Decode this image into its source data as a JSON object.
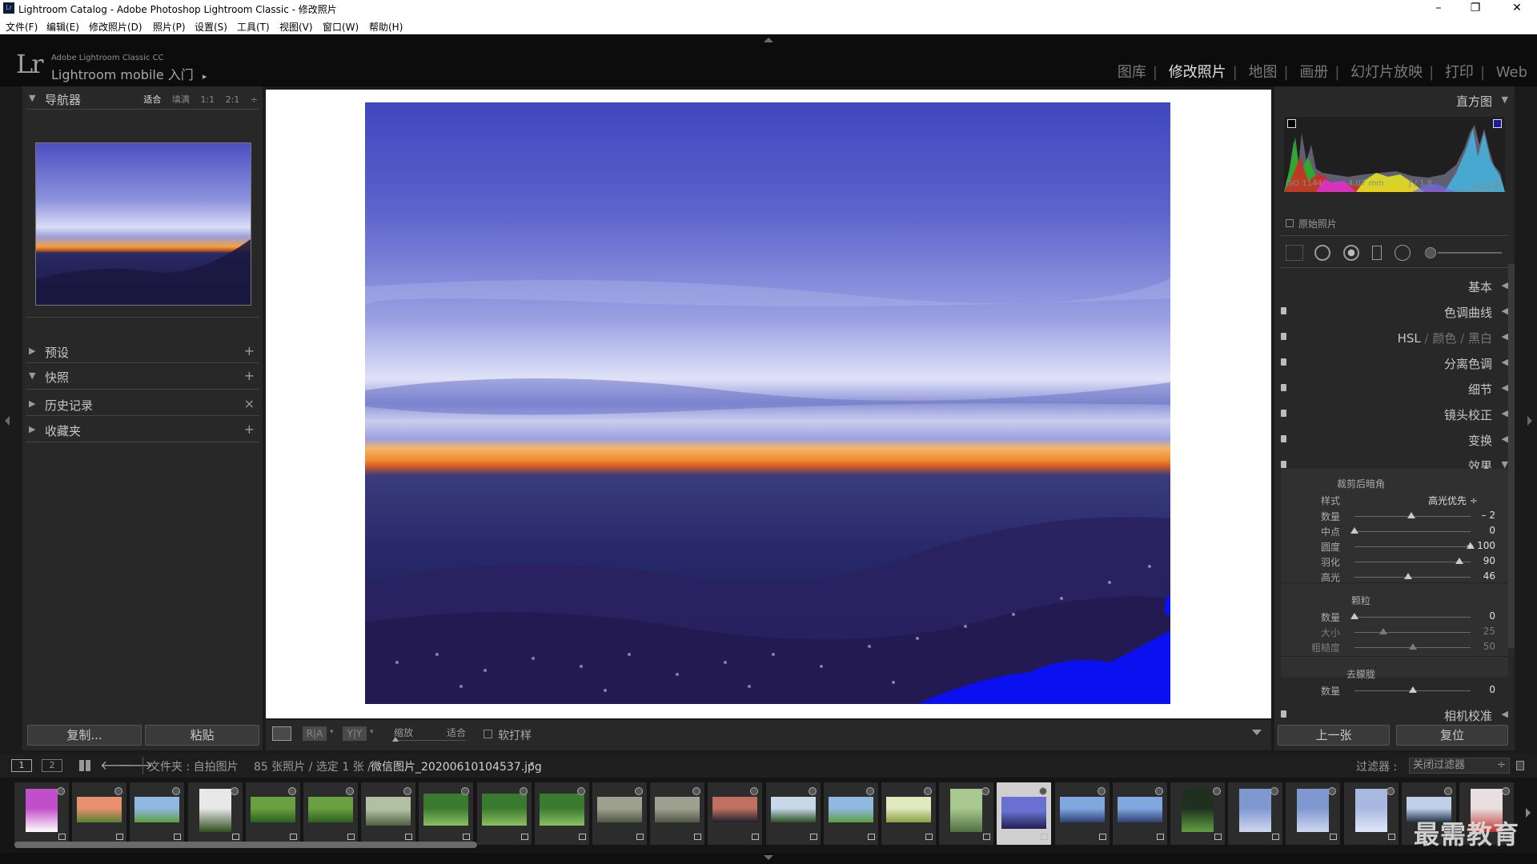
{
  "titlebar": {
    "app_icon": "Lr",
    "title": "Lightroom Catalog - Adobe Photoshop Lightroom Classic - 修改照片",
    "minimize": "–",
    "restore": "❐",
    "close": "✕"
  },
  "menu": [
    "文件(F)",
    "编辑(E)",
    "修改照片(D)",
    "照片(P)",
    "设置(S)",
    "工具(T)",
    "视图(V)",
    "窗口(W)",
    "帮助(H)"
  ],
  "identity": {
    "logo": "Lr",
    "product": "Adobe Lightroom Classic CC",
    "mobile": "Lightroom mobile 入门",
    "mobile_arrow": "▸"
  },
  "modules": {
    "items": [
      "图库",
      "修改照片",
      "地图",
      "画册",
      "幻灯片放映",
      "打印",
      "Web"
    ],
    "active_index": 1
  },
  "left_panel": {
    "navigator": {
      "label": "导航器",
      "zoom_options": [
        "适合",
        "填满",
        "1:1",
        "2:1"
      ],
      "active_zoom": "适合"
    },
    "sections": [
      {
        "label": "预设",
        "action": "+"
      },
      {
        "label": "快照",
        "action": "+"
      },
      {
        "label": "历史记录",
        "action": "×"
      },
      {
        "label": "收藏夹",
        "action": "+"
      }
    ],
    "copy_button": "复制...",
    "paste_button": "粘贴"
  },
  "toolbar": {
    "zoom_label": "缩放",
    "zoom_value": "适合",
    "soft_proof": "软打样",
    "ba_label": "R|A",
    "yy_label": "Y|Y"
  },
  "right_panel": {
    "histogram": {
      "label": "直方图",
      "iso": "ISO 1144",
      "focal": "4.07 mm",
      "aperture": "ƒ / 1.8",
      "shutter": "1/20 秒",
      "original_photo": "原始照片"
    },
    "sections": [
      {
        "label": "基本"
      },
      {
        "label": "色调曲线"
      },
      {
        "label": "HSL",
        "extra": [
          "颜色",
          "黑白"
        ]
      },
      {
        "label": "分离色调"
      },
      {
        "label": "细节"
      },
      {
        "label": "镜头校正"
      },
      {
        "label": "变换"
      },
      {
        "label": "效果"
      }
    ],
    "vignette": {
      "title": "裁剪后暗角",
      "style_label": "样式",
      "style_value": "高光优先 ÷",
      "sliders": [
        {
          "label": "数量",
          "value": "– 2",
          "pos": 0.49
        },
        {
          "label": "中点",
          "value": "0",
          "pos": 0.0
        },
        {
          "label": "圆度",
          "value": "+ 100",
          "pos": 1.0
        },
        {
          "label": "羽化",
          "value": "90",
          "pos": 0.9
        },
        {
          "label": "高光",
          "value": "46",
          "pos": 0.46
        }
      ]
    },
    "grain": {
      "title": "颗粒",
      "sliders": [
        {
          "label": "数量",
          "value": "0",
          "pos": 0.0,
          "dim": false
        },
        {
          "label": "大小",
          "value": "25",
          "pos": 0.25,
          "dim": true
        },
        {
          "label": "粗糙度",
          "value": "50",
          "pos": 0.5,
          "dim": true
        }
      ]
    },
    "dehaze": {
      "title": "去朦胧",
      "sliders": [
        {
          "label": "数量",
          "value": "0",
          "pos": 0.5
        }
      ]
    },
    "camera_calib": "相机校准",
    "prev_button": "上一张",
    "reset_button": "复位"
  },
  "filmbar": {
    "screen1": "1",
    "screen2": "2",
    "source": "文件夹 : 自拍图片",
    "count": "85 张照片 / 选定 1 张 /",
    "filename": "微信图片_20200610104537.jpg",
    "filter_label": "过滤器 :",
    "filter_value": "关闭过滤器"
  },
  "filmstrip": [
    {
      "type": "flower"
    },
    {
      "type": "sunset-land"
    },
    {
      "type": "field"
    },
    {
      "type": "tree"
    },
    {
      "type": "green"
    },
    {
      "type": "green"
    },
    {
      "type": "park"
    },
    {
      "type": "leaves"
    },
    {
      "type": "leaves"
    },
    {
      "type": "leaves"
    },
    {
      "type": "road"
    },
    {
      "type": "road"
    },
    {
      "type": "dusk"
    },
    {
      "type": "trees"
    },
    {
      "type": "field"
    },
    {
      "type": "field-light"
    },
    {
      "type": "portrait-green"
    },
    {
      "type": "selected-sky"
    },
    {
      "type": "sky-blue"
    },
    {
      "type": "sky-blue"
    },
    {
      "type": "night"
    },
    {
      "type": "blue-portrait"
    },
    {
      "type": "blue-portrait"
    },
    {
      "type": "sky-pale"
    },
    {
      "type": "lake"
    },
    {
      "type": "flowers-red"
    }
  ],
  "watermark": "最需教育"
}
